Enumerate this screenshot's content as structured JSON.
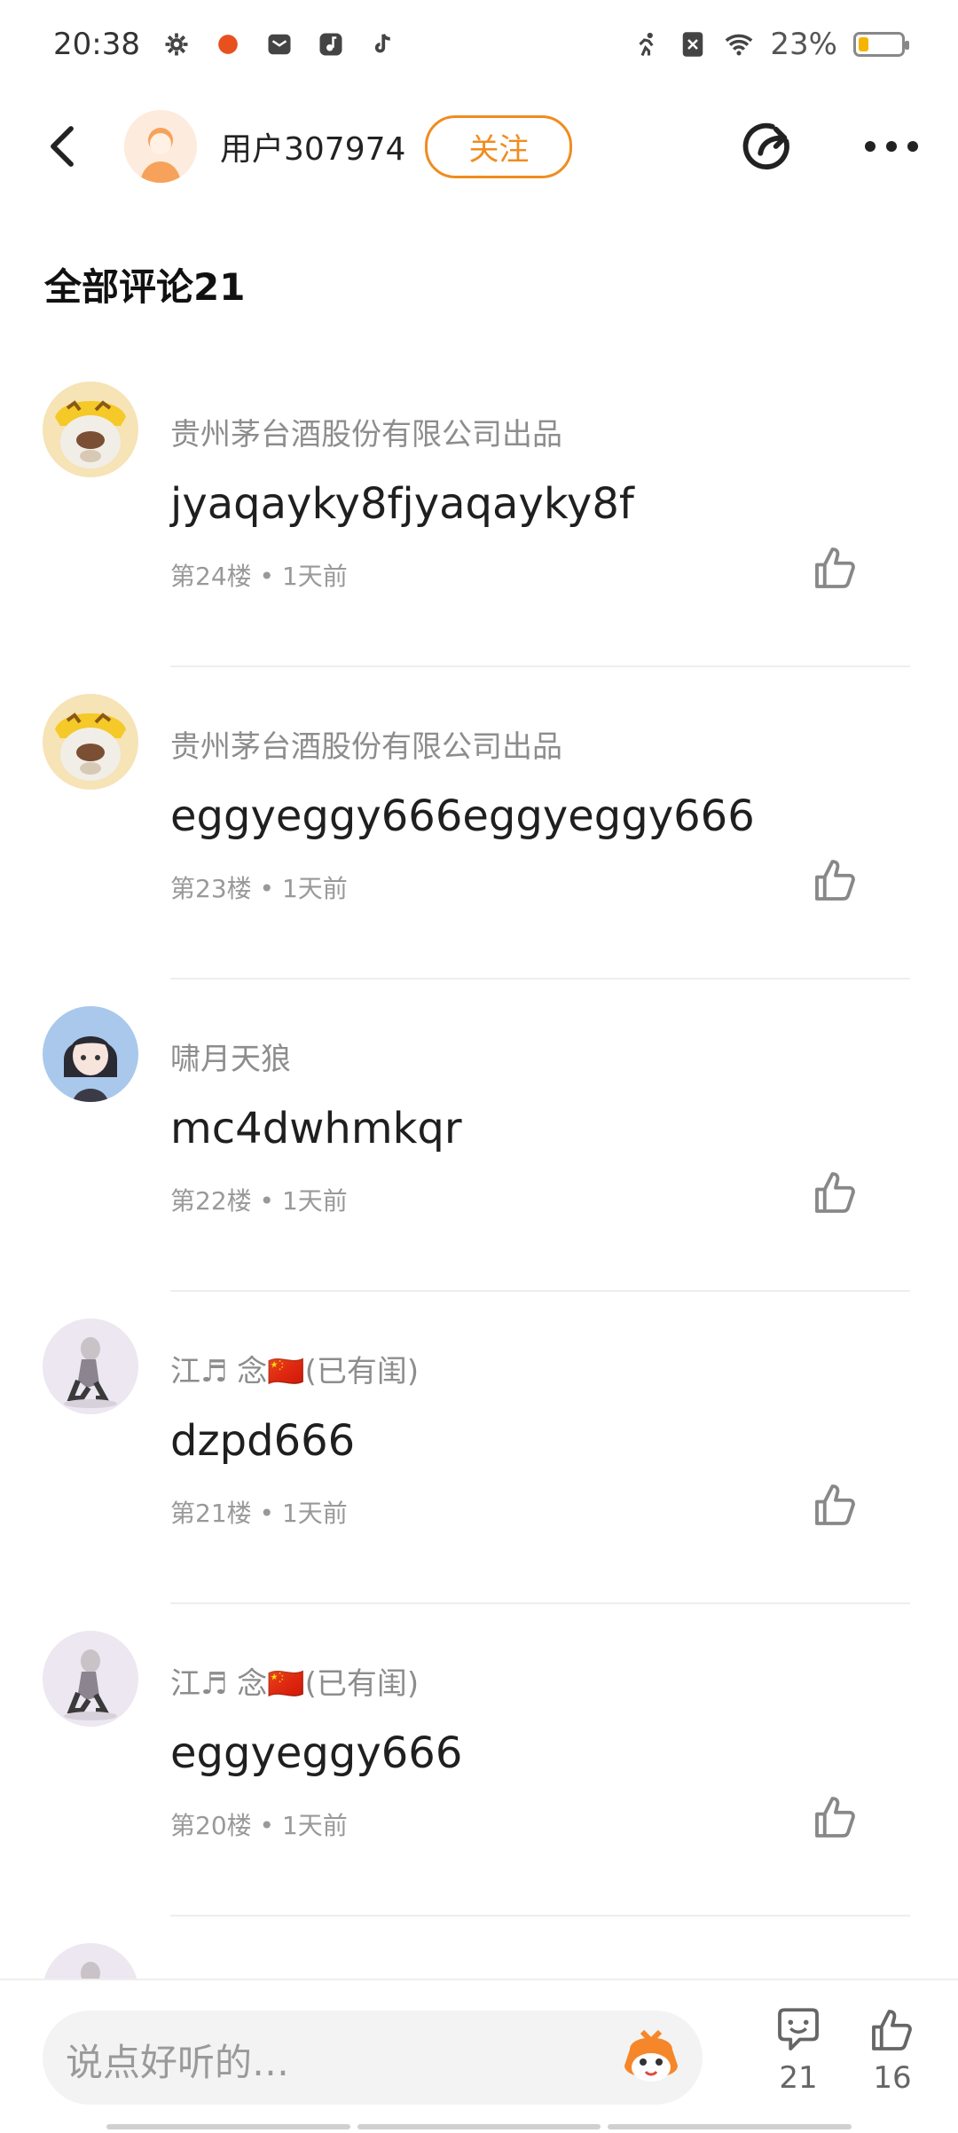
{
  "status_bar": {
    "time": "20:38",
    "battery": "23%",
    "battery_level": 0.23
  },
  "header": {
    "username": "用户307974",
    "follow_label": "关注"
  },
  "comments_title": "全部评论21",
  "comments": [
    {
      "author": "贵州茅台酒股份有限公司出品",
      "text": "jyaqayky8fjyaqayky8f",
      "floor": "第24楼",
      "time": "1天前",
      "avatar": "tiger-dog"
    },
    {
      "author": "贵州茅台酒股份有限公司出品",
      "text": "eggyeggy666eggyeggy666",
      "floor": "第23楼",
      "time": "1天前",
      "avatar": "tiger-dog"
    },
    {
      "author": "啸月天狼",
      "text": "mc4dwhmkqr",
      "floor": "第22楼",
      "time": "1天前",
      "avatar": "anime-girl"
    },
    {
      "author": "江♬ 念🇨🇳(已有闺)",
      "text": "dzpd666",
      "floor": "第21楼",
      "time": "1天前",
      "avatar": "anime-figure"
    },
    {
      "author": "江♬ 念🇨🇳(已有闺)",
      "text": "eggyeggy666",
      "floor": "第20楼",
      "time": "1天前",
      "avatar": "anime-figure"
    }
  ],
  "meta_separator": "•",
  "bottom_bar": {
    "input_placeholder": "说点好听的…",
    "comment_count": "21",
    "like_count": "16"
  }
}
